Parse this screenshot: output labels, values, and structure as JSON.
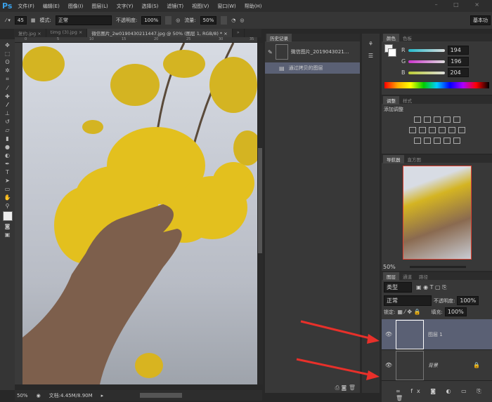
{
  "app": {
    "logo": "Ps",
    "window_controls": "– □ ×"
  },
  "menu": [
    "文件(F)",
    "编辑(E)",
    "图像(I)",
    "图层(L)",
    "文字(Y)",
    "选择(S)",
    "滤镜(T)",
    "视图(V)",
    "窗口(W)",
    "帮助(H)"
  ],
  "options": {
    "brush_size": "45",
    "mode_label": "模式:",
    "mode_value": "正常",
    "opacity_label": "不透明度:",
    "opacity_value": "100%",
    "flow_label": "流量:",
    "flow_value": "50%",
    "workspace": "基本功"
  },
  "tabs": [
    {
      "label": "复约.jpg ×"
    },
    {
      "label": "timg (3).jpg ×"
    },
    {
      "label": "微信图片_2w0190430211447.jpg @ 50% (图层 1, RGB/8) * ×"
    }
  ],
  "tabs_overflow": "»",
  "ruler": [
    "0",
    "5",
    "10",
    "15",
    "20",
    "25",
    "30",
    "35"
  ],
  "status": {
    "zoom": "50%",
    "doc": "文档:4.45M/8.90M"
  },
  "history": {
    "title": "历史记录",
    "items": [
      {
        "label": "微信图片_2019043021..."
      },
      {
        "label": "通过拷贝的图层"
      }
    ]
  },
  "color": {
    "tabs": [
      "颜色",
      "色板"
    ],
    "r": 194,
    "g": 196,
    "b": 204
  },
  "adjustments": {
    "tabs": [
      "调整",
      "样式"
    ],
    "title": "添加调整"
  },
  "navigator": {
    "tabs": [
      "导航器",
      "直方图"
    ],
    "zoom": "50%"
  },
  "layers": {
    "tabs": [
      "图层",
      "通道",
      "路径"
    ],
    "filter": "类型",
    "blend": "正常",
    "opacity_label": "不透明度:",
    "opacity": "100%",
    "lock_label": "锁定:",
    "fill_label": "填充:",
    "fill": "100%",
    "items": [
      {
        "name": "图层 1",
        "selected": true
      },
      {
        "name": "背景",
        "locked": true
      }
    ]
  },
  "colors": {
    "accent": "#3aa0e8",
    "selected_layer": "#5a6074",
    "arrow": "#e8302a"
  }
}
